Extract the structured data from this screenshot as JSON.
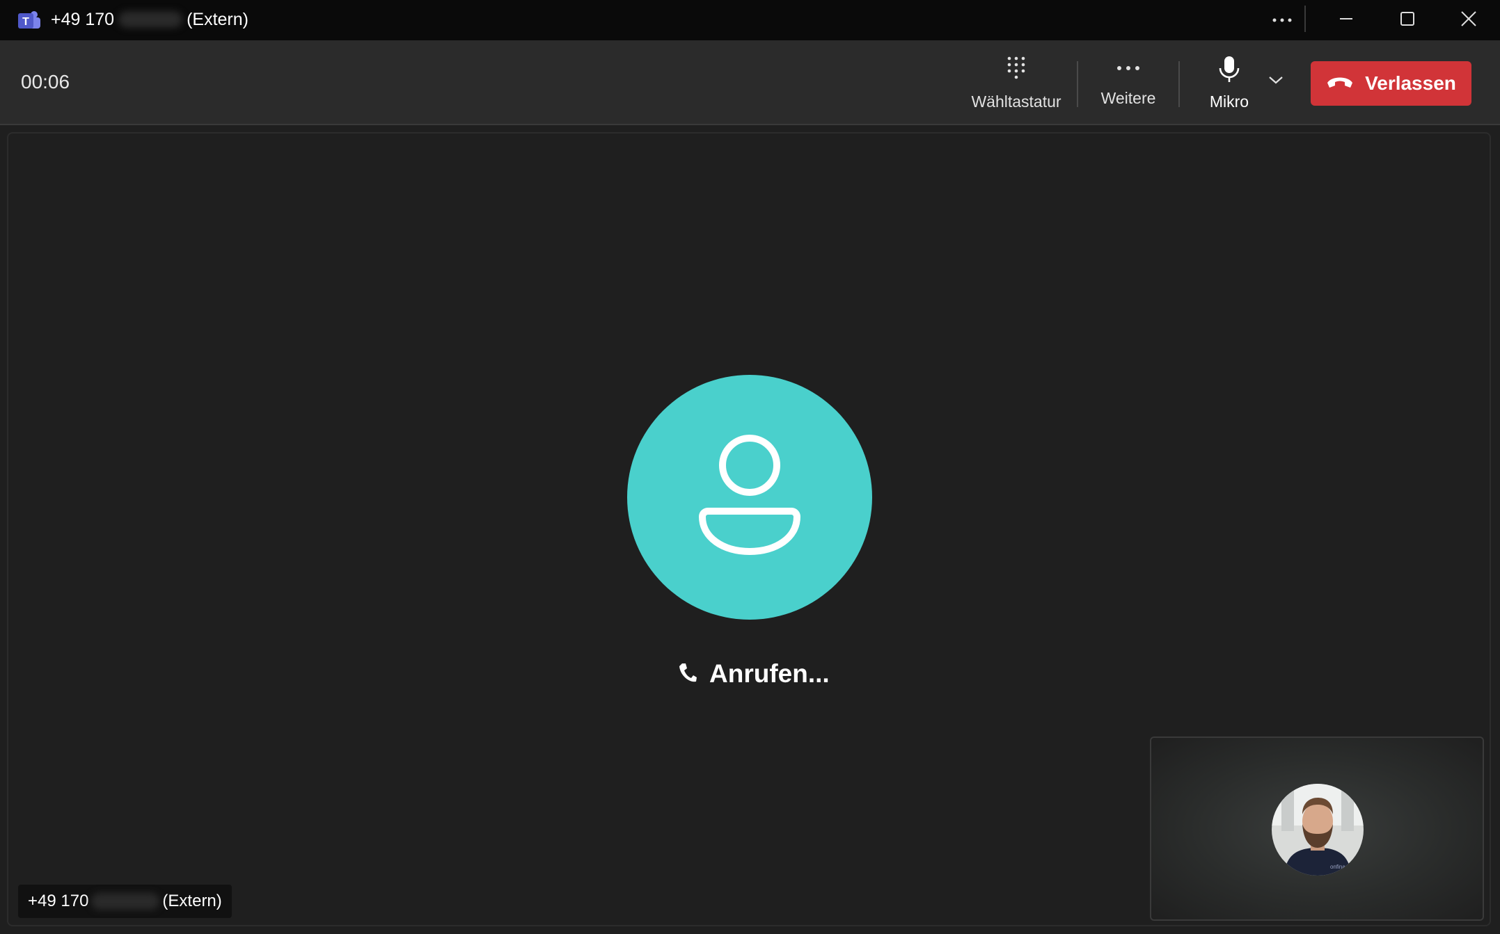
{
  "window": {
    "title_prefix": "+49 170",
    "title_suffix": "(Extern)",
    "app_icon": "teams-icon",
    "controls": [
      "more-icon",
      "minimize-icon",
      "maximize-icon",
      "close-icon"
    ]
  },
  "toolbar": {
    "timer": "00:06",
    "dialpad_label": "Wähltastatur",
    "more_label": "Weitere",
    "mic_label": "Mikro",
    "leave_label": "Verlassen"
  },
  "call": {
    "status": "Anrufen...",
    "caller_prefix": "+49 170",
    "caller_suffix": "(Extern)"
  },
  "colors": {
    "leave": "#d13438",
    "avatar": "#4ad0cc",
    "titlebar": "#0a0a0a",
    "toolbar": "#2b2b2b"
  }
}
